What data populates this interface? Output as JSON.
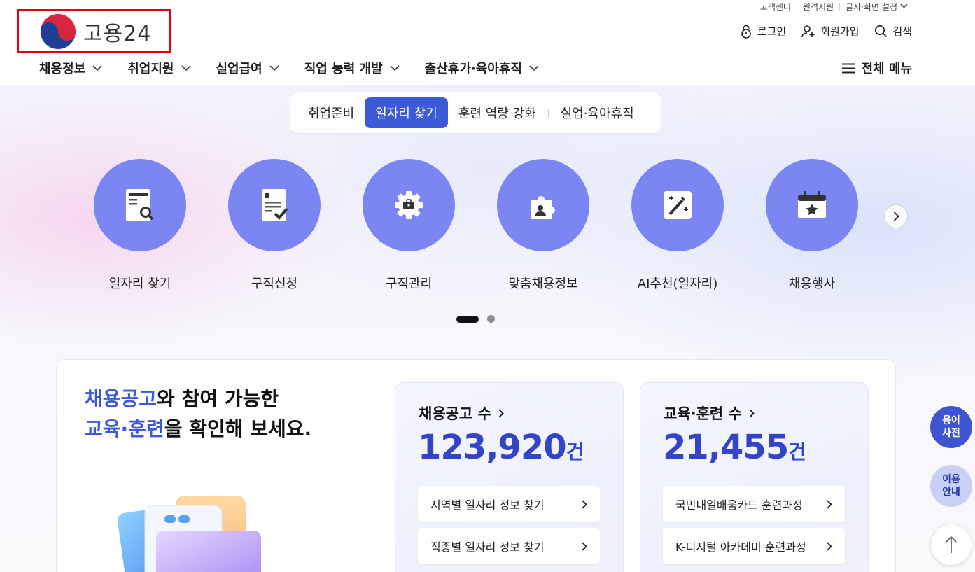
{
  "header": {
    "util_links": [
      "고객센터",
      "원격지원",
      "글자·화면 설정"
    ],
    "logo_text": "고용24",
    "actions": {
      "login": "로그인",
      "signup": "회원가입",
      "search": "검색"
    },
    "gnb": [
      "채용정보",
      "취업지원",
      "실업급여",
      "직업 능력 개발",
      "출산휴가·육아휴직"
    ],
    "all_menu": "전체 메뉴"
  },
  "hero": {
    "tabs": [
      "취업준비",
      "일자리 찾기",
      "훈련 역량 강화",
      "실업·육아휴직"
    ],
    "active_tab": "일자리 찾기",
    "services": [
      "일자리 찾기",
      "구직신청",
      "구직관리",
      "맞춤채용정보",
      "AI추천(일자리)",
      "채용행사"
    ],
    "carousel": {
      "pages": 2,
      "current": 1
    }
  },
  "panel": {
    "title_line1_highlight": "채용공고",
    "title_line1_rest": "와 참여 가능한",
    "title_line2_highlight": "교육·훈련",
    "title_line2_rest": "을 확인해 보세요.",
    "job_card": {
      "title": "채용공고 수",
      "count": "123,920",
      "unit": "건",
      "links": [
        "지역별 일자리 정보 찾기",
        "직종별 일자리 정보 찾기"
      ]
    },
    "training_card": {
      "title": "교육·훈련 수",
      "count": "21,455",
      "unit": "건",
      "links": [
        "국민내일배움카드 훈련과정",
        "K-디지털 아카데미 훈련과정"
      ]
    }
  },
  "floating": {
    "dict_line1": "용어",
    "dict_line2": "사전",
    "guide_line1": "이용",
    "guide_line2": "안내"
  },
  "colors": {
    "primary": "#3d5ad6",
    "service_circle": "#7c86f2",
    "logo_red": "#e00012",
    "stat_number": "#3344c7"
  }
}
